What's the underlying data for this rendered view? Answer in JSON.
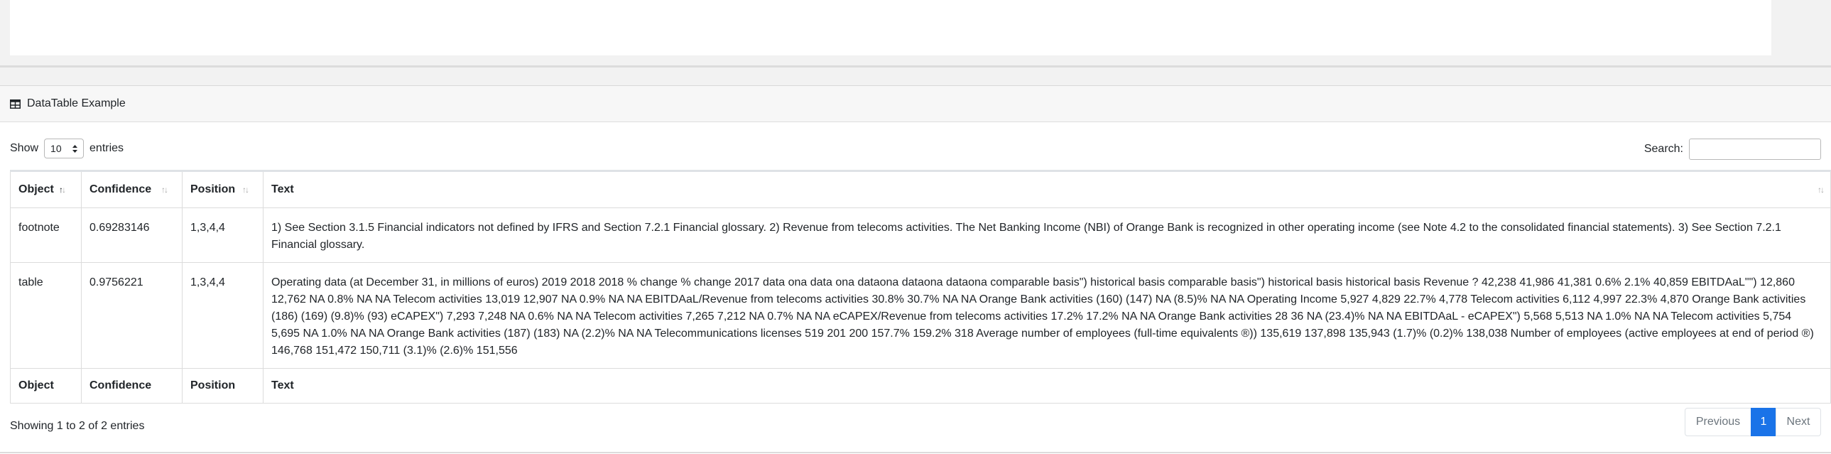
{
  "card": {
    "title": "DataTable Example"
  },
  "length": {
    "label_before": "Show",
    "value": "10",
    "label_after": "entries"
  },
  "search": {
    "label": "Search:",
    "value": ""
  },
  "table": {
    "columns": [
      "Object",
      "Confidence",
      "Position",
      "Text"
    ],
    "rows": [
      {
        "object": "footnote",
        "confidence": "0.69283146",
        "position": "1,3,4,4",
        "text": "1) See Section 3.1.5 Financial indicators not defined by IFRS and Section 7.2.1 Financial glossary. 2) Revenue from telecoms activities. The Net Banking Income (NBI) of Orange Bank is recognized in other operating income (see Note 4.2 to the consolidated financial statements). 3) See Section 7.2.1 Financial glossary."
      },
      {
        "object": "table",
        "confidence": "0.9756221",
        "position": "1,3,4,4",
        "text": "Operating data (at December 31, in millions of euros) 2019 2018 2018 % change % change 2017 data ona data ona dataona dataona dataona comparable basis\") historical basis comparable basis\") historical basis historical basis Revenue ? 42,238 41,986 41,381 0.6% 2.1% 40,859 EBITDAaL\"\") 12,860 12,762 NA 0.8% NA NA Telecom activities 13,019 12,907 NA 0.9% NA NA EBITDAaL/Revenue from telecoms activities 30.8% 30.7% NA NA Orange Bank activities (160) (147) NA (8.5)% NA NA Operating Income 5,927 4,829 22.7% 4,778 Telecom activities 6,112 4,997 22.3% 4,870 Orange Bank activities (186) (169) (9.8)% (93) eCAPEX\") 7,293 7,248 NA 0.6% NA NA Telecom activities 7,265 7,212 NA 0.7% NA NA eCAPEX/Revenue from telecoms activities 17.2% 17.2% NA NA Orange Bank activities 28 36 NA (23.4)% NA NA EBITDAaL - eCAPEX\") 5,568 5,513 NA 1.0% NA NA Telecom activities 5,754 5,695 NA 1.0% NA NA Orange Bank activities (187) (183) NA (2.2)% NA NA Telecommunications licenses 519 201 200 157.7% 159.2% 318 Average number of employees (full-time equivalents ®)) 135,619 137,898 135,943 (1.7)% (0.2)% 138,038 Number of employees (active employees at end of period ®) 146,768 151,472 150,711 (3.1)% (2.6)% 151,556"
      }
    ]
  },
  "info": "Showing 1 to 2 of 2 entries",
  "pagination": {
    "previous": "Previous",
    "current": "1",
    "next": "Next"
  },
  "colors": {
    "accent": "#1a73e8",
    "header_bg": "#f7f7f7",
    "border": "#dcdcdc"
  }
}
